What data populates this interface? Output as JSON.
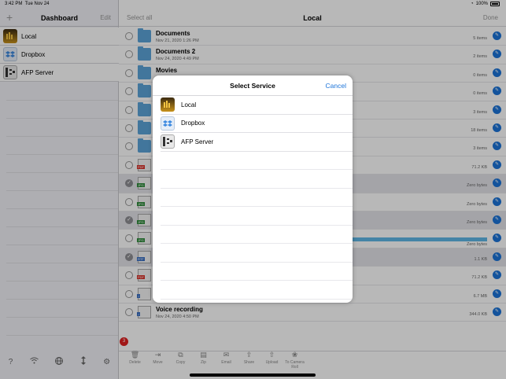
{
  "status": {
    "time": "3:42 PM",
    "date": "Tue Nov 24",
    "battery": "100%"
  },
  "sidebar": {
    "add_label": "+",
    "title": "Dashboard",
    "edit_label": "Edit",
    "items": [
      {
        "label": "Local",
        "icon": "local-drive-icon"
      },
      {
        "label": "Dropbox",
        "icon": "dropbox-icon"
      },
      {
        "label": "AFP Server",
        "icon": "server-icon"
      }
    ],
    "bottom": [
      "?",
      "wifi-icon",
      "globe-icon",
      "transfer-icon",
      "gear-icon"
    ]
  },
  "main": {
    "select_all": "Select all",
    "title": "Local",
    "done": "Done",
    "rows": [
      {
        "type": "folder",
        "name": "Documents",
        "date": "Nov 21, 2020 1:26 PM",
        "size": "5 items",
        "selected": false
      },
      {
        "type": "folder",
        "name": "Documents 2",
        "date": "Nov 24, 2020 4:49 PM",
        "size": "2 items",
        "selected": false
      },
      {
        "type": "folder",
        "name": "Movies",
        "date": "",
        "size": "0 items",
        "selected": false
      },
      {
        "type": "folder",
        "name": "",
        "date": "",
        "size": "0 items",
        "selected": false
      },
      {
        "type": "folder",
        "name": "",
        "date": "",
        "size": "3 items",
        "selected": false
      },
      {
        "type": "folder",
        "name": "",
        "date": "",
        "size": "18 items",
        "selected": false
      },
      {
        "type": "folder",
        "name": "",
        "date": "",
        "size": "3 items",
        "selected": false
      },
      {
        "type": "pdf",
        "name": "",
        "date": "",
        "size": "71.2 KB",
        "selected": false
      },
      {
        "type": "jpg",
        "name": "",
        "date": "",
        "size": "Zero bytes",
        "selected": true
      },
      {
        "type": "jpg",
        "name": "",
        "date": "",
        "size": "Zero bytes",
        "selected": false
      },
      {
        "type": "jpg",
        "name": "",
        "date": "",
        "size": "Zero bytes",
        "selected": true
      },
      {
        "type": "jpg",
        "name": "",
        "date": "",
        "size": "Zero bytes",
        "selected": false,
        "progress": true
      },
      {
        "type": "rtf",
        "name": "",
        "date": "",
        "size": "1.1 KB",
        "selected": true
      },
      {
        "type": "pdf",
        "name": "",
        "date": "",
        "size": "71.2 KB",
        "selected": false
      },
      {
        "type": "audio",
        "name": "",
        "date": "",
        "size": "6.7 MB",
        "selected": false
      },
      {
        "type": "audio",
        "name": "Voice recording",
        "date": "Nov 24, 2020 4:50 PM",
        "size": "344.0 KB",
        "selected": false
      }
    ]
  },
  "toolbar": {
    "badge": "3",
    "buttons": [
      {
        "label": "Delete",
        "glyph": "🗑"
      },
      {
        "label": "Move",
        "glyph": "⇥"
      },
      {
        "label": "Copy",
        "glyph": "⧉"
      },
      {
        "label": "Zip",
        "glyph": "▤"
      },
      {
        "label": "Email",
        "glyph": "✉"
      },
      {
        "label": "Share",
        "glyph": "⇪"
      },
      {
        "label": "Upload",
        "glyph": "⇧"
      },
      {
        "label": "To Camera Roll",
        "glyph": "❀"
      }
    ]
  },
  "modal": {
    "title": "Select Service",
    "cancel": "Cancel",
    "items": [
      {
        "label": "Local"
      },
      {
        "label": "Dropbox"
      },
      {
        "label": "AFP Server"
      }
    ]
  }
}
